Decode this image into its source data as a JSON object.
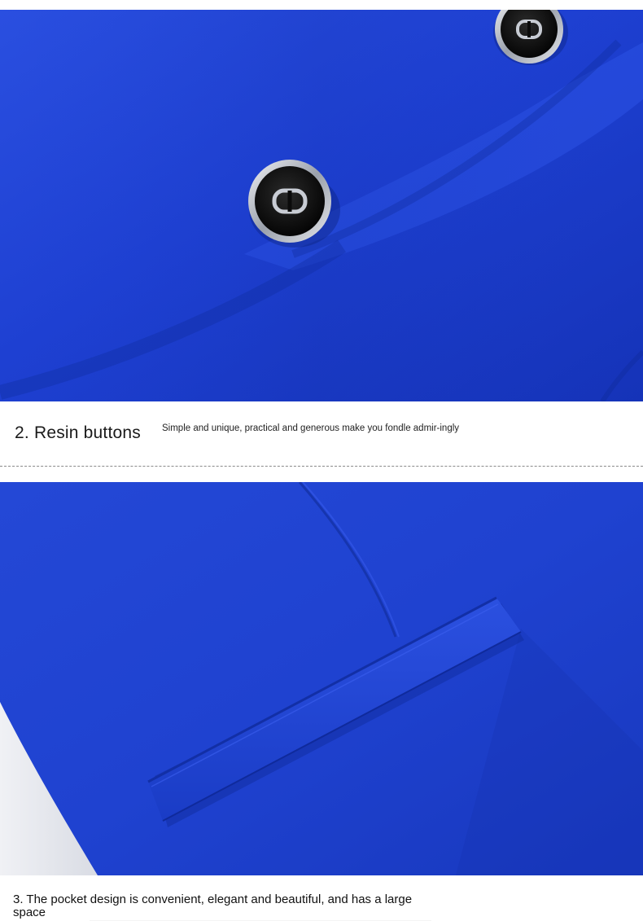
{
  "sections": [
    {
      "id": "resin-buttons",
      "photo": {
        "description_icon": "resin-button-closeup",
        "fabric_color": "#1c3fcf"
      },
      "title": "2. Resin buttons",
      "description": "Simple and unique, practical and generous make you fondle admir-ingly"
    },
    {
      "id": "pocket",
      "photo": {
        "description_icon": "pocket-closeup",
        "fabric_color": "#1f42d0"
      },
      "title": "3. The pocket design is convenient, elegant and beautiful, and has a large space"
    }
  ],
  "colors": {
    "fabric_blue": "#1c3fcf",
    "fabric_shadow": "#0f2a9c",
    "button_black": "#0b0b0b",
    "button_rim": "#c9ccd3",
    "divider": "#8a8a8a"
  }
}
